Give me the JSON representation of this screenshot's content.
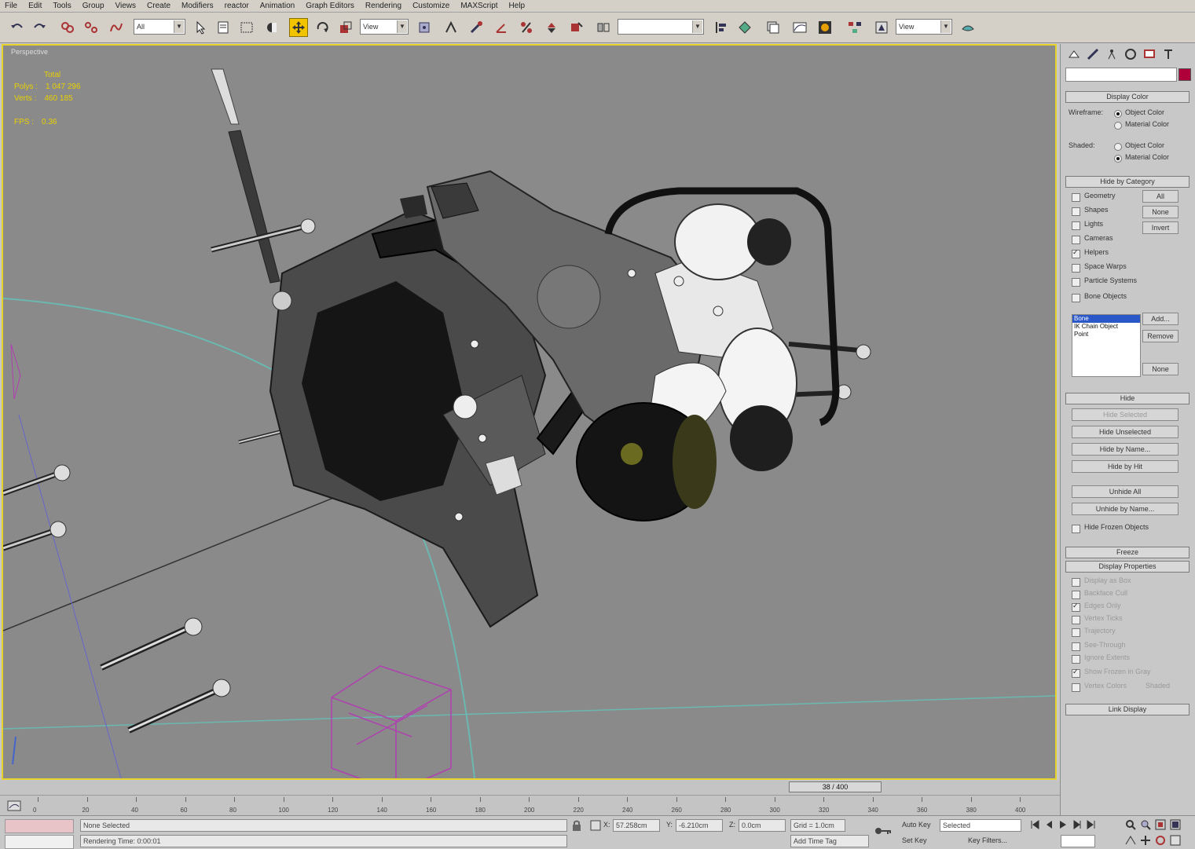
{
  "menu": [
    "File",
    "Edit",
    "Tools",
    "Group",
    "Views",
    "Create",
    "Modifiers",
    "reactor",
    "Animation",
    "Graph Editors",
    "Rendering",
    "Customize",
    "MAXScript",
    "Help"
  ],
  "toolbar": {
    "selection_filter": "All",
    "reference_coord": "View",
    "named_selection": "",
    "render_type": "View"
  },
  "viewport": {
    "label": "Perspective",
    "stats": {
      "title": "Total",
      "polys_label": "Polys :",
      "polys_value": "1 047 296",
      "verts_label": "Verts :",
      "verts_value": "460 185",
      "fps_label": "FPS :",
      "fps_value": "0.36"
    }
  },
  "command_panel": {
    "display_color": {
      "header": "Display Color",
      "wireframe_label": "Wireframe:",
      "shaded_label": "Shaded:",
      "object_color": "Object Color",
      "material_color": "Material Color"
    },
    "hide_by_category": {
      "header": "Hide by Category",
      "items": [
        "Geometry",
        "Shapes",
        "Lights",
        "Cameras",
        "Helpers",
        "Space Warps",
        "Particle Systems",
        "Bone Objects"
      ],
      "checked": [
        false,
        false,
        false,
        false,
        true,
        false,
        false,
        false
      ],
      "all": "All",
      "none": "None",
      "invert": "Invert",
      "list": [
        "Bone",
        "IK Chain Object",
        "Point"
      ],
      "add": "Add...",
      "remove": "Remove",
      "none2": "None"
    },
    "hide": {
      "header": "Hide",
      "hide_selected": "Hide Selected",
      "hide_unselected": "Hide Unselected",
      "hide_by_name": "Hide by Name...",
      "hide_by_hit": "Hide by Hit",
      "unhide_all": "Unhide All",
      "unhide_by_name": "Unhide by Name...",
      "hide_frozen": "Hide Frozen Objects"
    },
    "freeze": {
      "header": "Freeze"
    },
    "display_properties": {
      "header": "Display Properties",
      "items": [
        "Display as Box",
        "Backface Cull",
        "Edges Only",
        "Vertex Ticks",
        "Trajectory",
        "See-Through",
        "Ignore Extents",
        "Show Frozen in Gray",
        "Vertex Colors"
      ],
      "shaded": "Shaded"
    },
    "link_display": {
      "header": "Link Display"
    }
  },
  "timeline": {
    "slider_label": "38 / 400",
    "ticks": [
      "0",
      "20",
      "40",
      "60",
      "80",
      "100",
      "120",
      "140",
      "160",
      "180",
      "200",
      "220",
      "240",
      "260",
      "280",
      "300",
      "320",
      "340",
      "360",
      "380",
      "400"
    ]
  },
  "statusbar": {
    "selection_status": "None Selected",
    "prompt": "Rendering Time: 0:00:01",
    "x_label": "X:",
    "x_value": "57.258cm",
    "y_label": "Y:",
    "y_value": "-6.210cm",
    "z_label": "Z:",
    "z_value": "0.0cm",
    "grid": "Grid = 1.0cm",
    "add_time_tag": "Add Time Tag",
    "auto_key": "Auto Key",
    "set_key": "Set Key",
    "key_filters": "Key Filters...",
    "selected": "Selected"
  }
}
